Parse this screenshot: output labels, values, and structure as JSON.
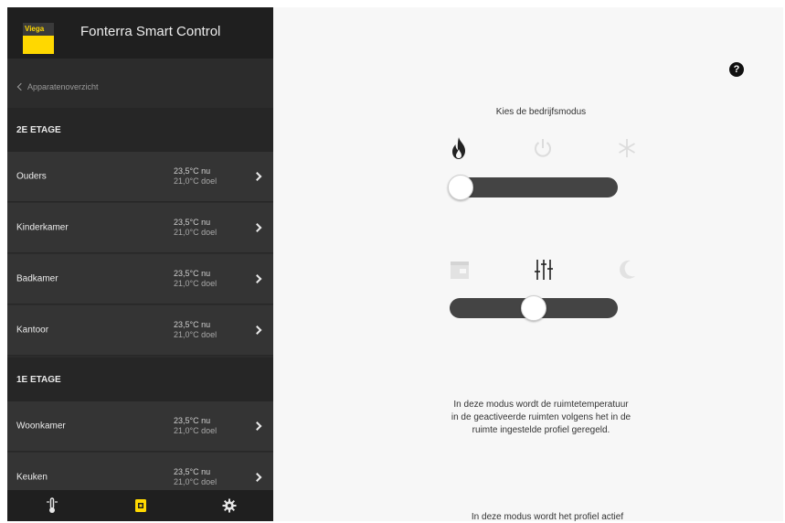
{
  "app": {
    "brand": "Viega",
    "title": "Fonterra Smart Control"
  },
  "sidebar": {
    "back_label": "Apparatenoverzicht",
    "sections": [
      {
        "title": "2E ETAGE",
        "rooms": [
          {
            "name": "Ouders",
            "current": "23,5°C nu",
            "target": "21,0°C doel"
          },
          {
            "name": "Kinderkamer",
            "current": "23,5°C nu",
            "target": "21,0°C doel"
          },
          {
            "name": "Badkamer",
            "current": "23,5°C nu",
            "target": "21,0°C doel"
          },
          {
            "name": "Kantoor",
            "current": "23,5°C nu",
            "target": "21,0°C doel"
          }
        ]
      },
      {
        "title": "1E ETAGE",
        "rooms": [
          {
            "name": "Woonkamer",
            "current": "23,5°C nu",
            "target": "21,0°C doel"
          },
          {
            "name": "Keuken",
            "current": "23,5°C nu",
            "target": "21,0°C doel"
          }
        ]
      }
    ],
    "tabs": [
      {
        "icon": "thermometer-icon",
        "active": false
      },
      {
        "icon": "device-icon",
        "active": true
      },
      {
        "icon": "gear-icon",
        "active": false
      }
    ]
  },
  "main": {
    "help_label": "?",
    "mode_heading": "Kies de bedrijfsmodus",
    "operating_modes": {
      "icons": [
        "flame-icon",
        "power-icon",
        "snowflake-icon"
      ],
      "selected_index": 0
    },
    "profile_modes": {
      "icons": [
        "calendar-icon",
        "sliders-icon",
        "moon-icon"
      ],
      "selected_index": 1
    },
    "description": "In deze modus wordt de ruimtetemperatuur in de geactiveerde ruimten volgens het in de ruimte ingestelde profiel geregeld.",
    "extra_text": "In deze modus wordt het profiel actief"
  },
  "colors": {
    "accent": "#ffd800",
    "sidebar_bg": "#2c2c2c",
    "slider_track": "#444444"
  }
}
